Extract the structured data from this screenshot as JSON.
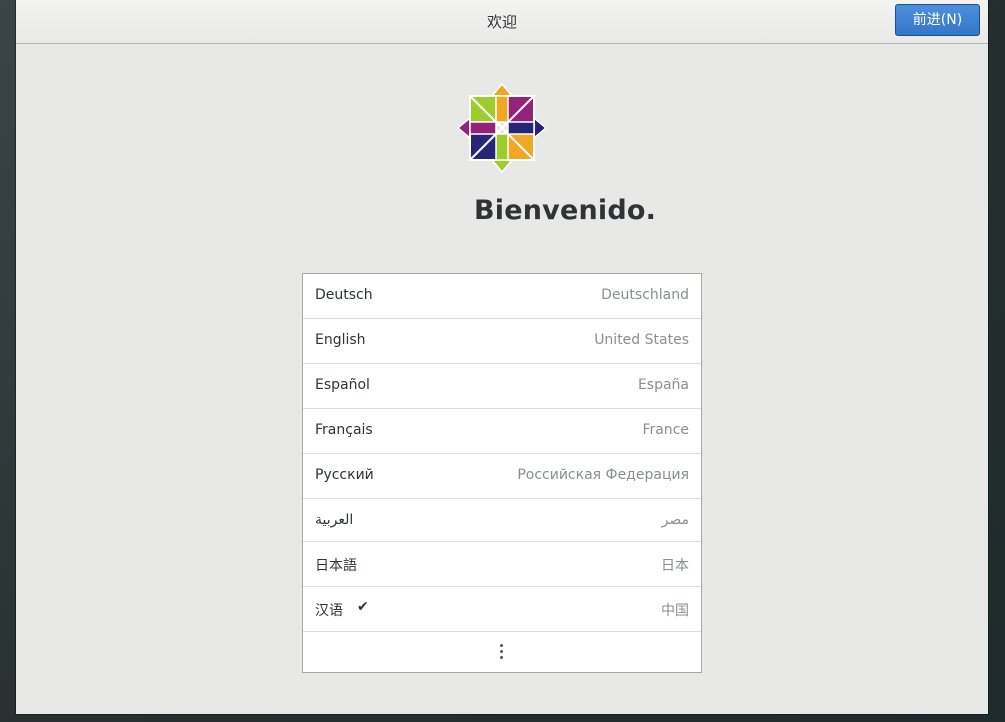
{
  "header": {
    "title": "欢迎",
    "next_button": "前进(N)"
  },
  "welcome": {
    "title": "Bienvenido."
  },
  "logo": {
    "icon": "centos-logo-icon",
    "colors": [
      "#9ccd2a",
      "#932279",
      "#efa724",
      "#262577"
    ]
  },
  "languages": [
    {
      "name": "Deutsch",
      "region": "Deutschland",
      "selected": false
    },
    {
      "name": "English",
      "region": "United States",
      "selected": false
    },
    {
      "name": "Español",
      "region": "España",
      "selected": false
    },
    {
      "name": "Français",
      "region": "France",
      "selected": false
    },
    {
      "name": "Русский",
      "region": "Российская Федерация",
      "selected": false
    },
    {
      "name": "العربية",
      "region": "مصر",
      "selected": false
    },
    {
      "name": "日本語",
      "region": "日本",
      "selected": false
    },
    {
      "name": "汉语",
      "region": "中国",
      "selected": true,
      "check": "✔"
    }
  ],
  "more_icon": "view-more-icon",
  "colors": {
    "accent": "#3476c9",
    "window_bg": "#e8e8e7"
  }
}
